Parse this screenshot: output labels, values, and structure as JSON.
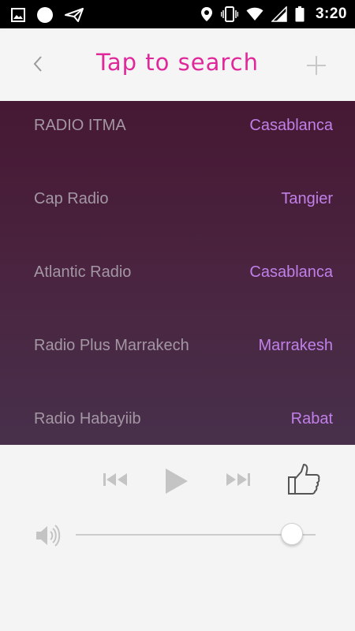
{
  "status_bar": {
    "time": "3:20",
    "left_icons": [
      "image-icon",
      "circle-icon",
      "paper-plane-icon"
    ],
    "right_icons": [
      "location-icon",
      "vibrate-icon",
      "wifi-icon",
      "signal-icon",
      "battery-icon"
    ]
  },
  "header": {
    "title": "Tap to search",
    "title_color": "#e0289a",
    "back_icon": "chevron-left-icon",
    "add_icon": "plus-icon"
  },
  "stations": [
    {
      "name": "RADIO ITMA",
      "city": "Casablanca"
    },
    {
      "name": "Cap Radio",
      "city": "Tangier"
    },
    {
      "name": "Atlantic Radio",
      "city": "Casablanca"
    },
    {
      "name": "Radio Plus Marrakech",
      "city": "Marrakesh"
    },
    {
      "name": "Radio Habayiib",
      "city": "Rabat"
    }
  ],
  "colors": {
    "list_bg_top": "#461833",
    "list_bg_bottom": "#48304b",
    "station_name": "#a397a3",
    "station_city": "#c080e8"
  },
  "player": {
    "controls": [
      "previous-icon",
      "play-icon",
      "next-icon",
      "thumbs-up-icon"
    ],
    "volume_icon": "speaker-icon",
    "volume_level": 0.9
  }
}
